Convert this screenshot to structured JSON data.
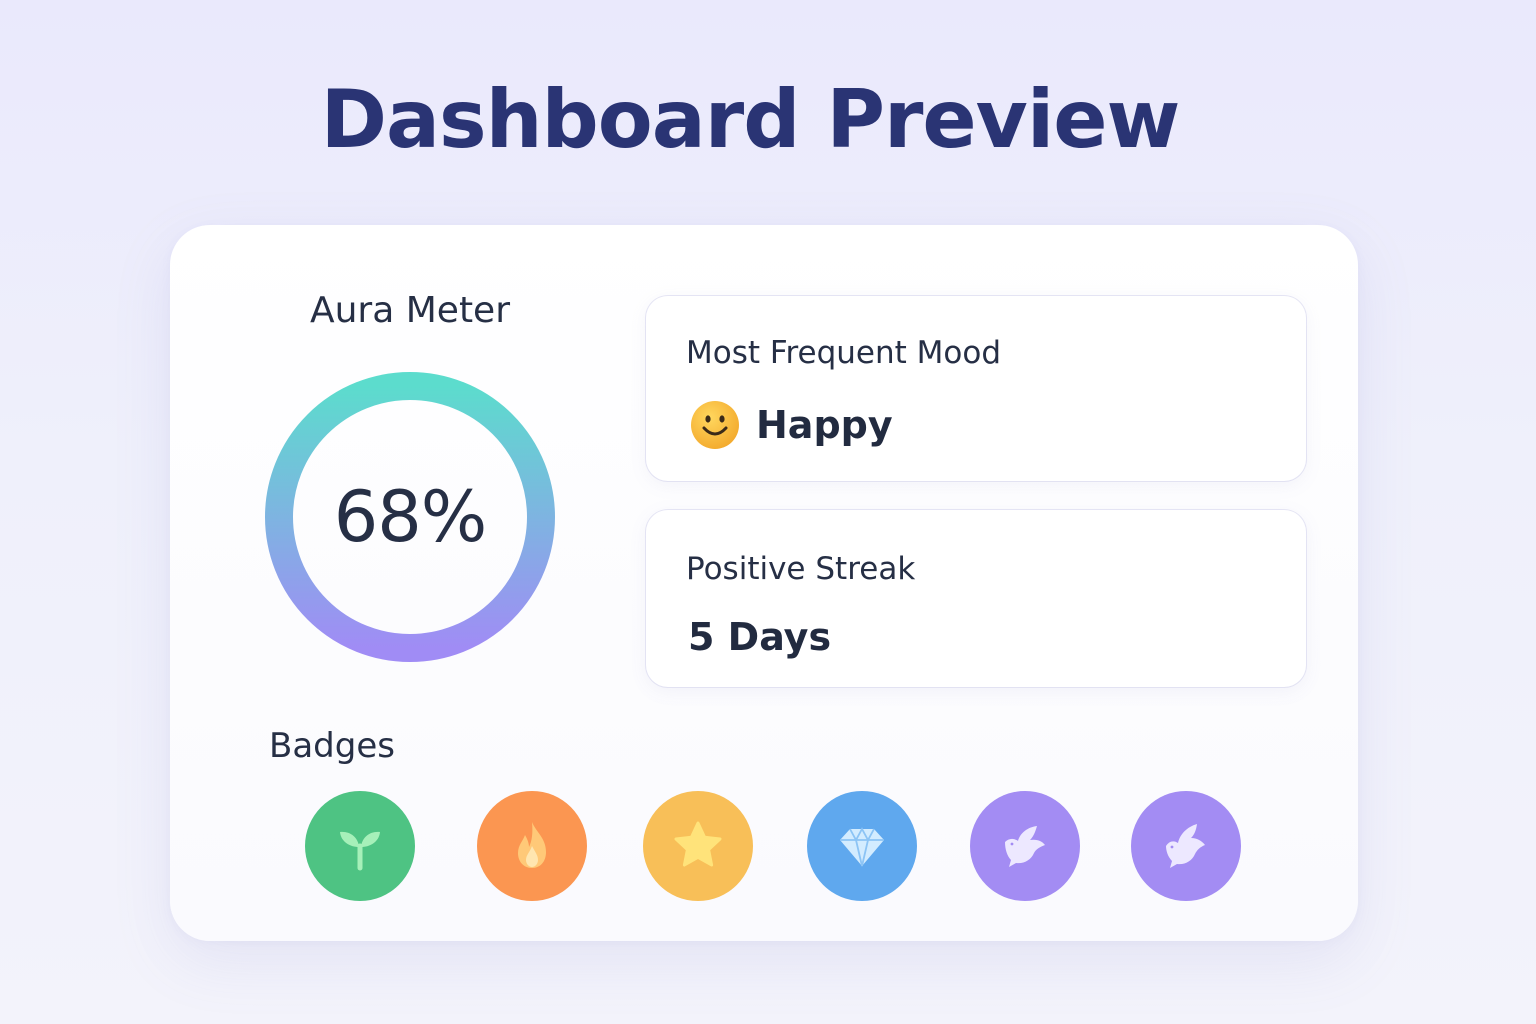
{
  "page": {
    "title": "Dashboard Preview"
  },
  "aura_meter": {
    "label": "Aura Meter",
    "value_text": "68%",
    "percent": 68,
    "gradient_top": "#5cdccd",
    "gradient_bottom": "#a08cf5"
  },
  "mood_card": {
    "title": "Most Frequent Mood",
    "value": "Happy",
    "icon": "smiley-icon"
  },
  "streak_card": {
    "title": "Positive Streak",
    "value": "5 Days"
  },
  "badges": {
    "label": "Badges",
    "items": [
      {
        "icon": "sprout-icon",
        "color": "#4ec383"
      },
      {
        "icon": "flame-icon",
        "color": "#fb9651"
      },
      {
        "icon": "star-icon",
        "color": "#f8bf58"
      },
      {
        "icon": "diamond-icon",
        "color": "#5fa8ee"
      },
      {
        "icon": "dove-icon",
        "color": "#a38cf3"
      },
      {
        "icon": "dove-icon",
        "color": "#a38cf3"
      }
    ]
  }
}
